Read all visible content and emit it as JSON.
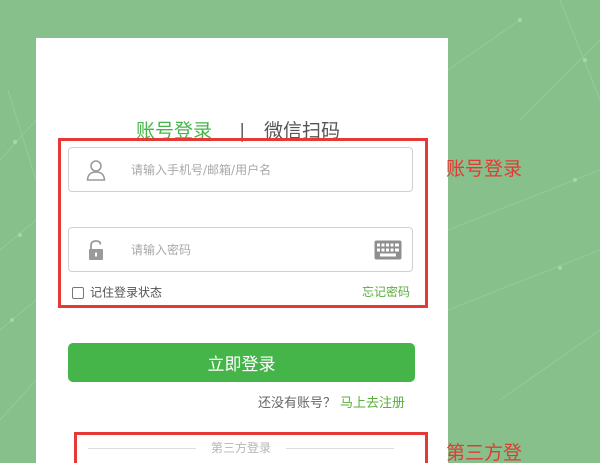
{
  "colors": {
    "background": "#87c08a",
    "accent": "#45b54a",
    "link": "#5aae3c",
    "annotation": "#e53935",
    "tab_inactive": "#555555"
  },
  "tabs": {
    "account_label": "账号登录",
    "separator": "|",
    "wechat_label": "微信扫码"
  },
  "form": {
    "username_placeholder": "请输入手机号/邮箱/用户名",
    "password_placeholder": "请输入密码",
    "username_icon": "user-icon",
    "password_icon": "lock-icon",
    "keyboard_icon": "keyboard-icon",
    "remember_label": "记住登录状态",
    "remember_checked": false,
    "forgot_label": "忘记密码"
  },
  "login_button_label": "立即登录",
  "register": {
    "prompt": "还没有账号？",
    "link_label": "马上去注册"
  },
  "third_party": {
    "label": "第三方登录"
  },
  "annotations": {
    "account_login": "账号登录",
    "third_party": "第三方登"
  }
}
